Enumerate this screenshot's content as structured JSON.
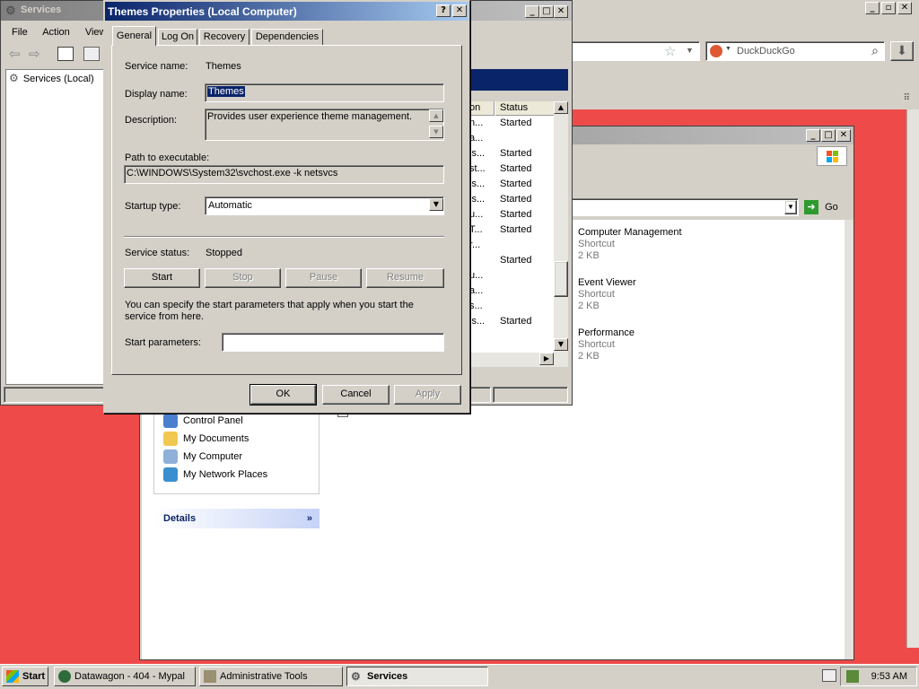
{
  "browser": {
    "search_placeholder": "DuckDuckGo",
    "win_controls": [
      "_",
      "□",
      "✕"
    ]
  },
  "explorer": {
    "address_go": "Go",
    "files": [
      {
        "name": "Computer Management",
        "type": "Shortcut",
        "size": "2 KB"
      },
      {
        "name": "Event Viewer",
        "type": "Shortcut",
        "size": "2 KB"
      },
      {
        "name": "Performance",
        "type": "Shortcut",
        "size": "2 KB"
      }
    ],
    "other_places": [
      "Control Panel",
      "My Documents",
      "My Computer",
      "My Network Places"
    ],
    "details_label": "Details"
  },
  "services_window": {
    "title": "Services",
    "menu": [
      "File",
      "Action",
      "View"
    ],
    "tree_item": "Services (Local)",
    "col_name_partial": "on",
    "col_status": "Status",
    "rows": [
      {
        "name": "n...",
        "status": "Started"
      },
      {
        "name": "a...",
        "status": ""
      },
      {
        "name": "is...",
        "status": "Started"
      },
      {
        "name": "st...",
        "status": "Started"
      },
      {
        "name": "is...",
        "status": "Started"
      },
      {
        "name": "is...",
        "status": "Started"
      },
      {
        "name": "u...",
        "status": "Started"
      },
      {
        "name": "T...",
        "status": "Started"
      },
      {
        "name": "r...",
        "status": ""
      },
      {
        "name": "",
        "status": "Started"
      },
      {
        "name": "u...",
        "status": ""
      },
      {
        "name": "a...",
        "status": ""
      },
      {
        "name": "s...",
        "status": ""
      },
      {
        "name": "is...",
        "status": "Started"
      },
      {
        "name": "",
        "status": ""
      }
    ]
  },
  "dialog": {
    "title": "Themes Properties (Local Computer)",
    "help": "?",
    "close": "✕",
    "tabs": [
      "General",
      "Log On",
      "Recovery",
      "Dependencies"
    ],
    "service_name_label": "Service name:",
    "service_name": "Themes",
    "display_name_label": "Display name:",
    "display_name": "Themes",
    "description_label": "Description:",
    "description": "Provides user experience theme management.",
    "path_label": "Path to executable:",
    "path": "C:\\WINDOWS\\System32\\svchost.exe -k netsvcs",
    "startup_label": "Startup type:",
    "startup_value": "Automatic",
    "status_label": "Service status:",
    "status_value": "Stopped",
    "btn_start": "Start",
    "btn_stop": "Stop",
    "btn_pause": "Pause",
    "btn_resume": "Resume",
    "hint": "You can specify the start parameters that apply when you start the service from here.",
    "params_label": "Start parameters:",
    "params_value": "",
    "ok": "OK",
    "cancel": "Cancel",
    "apply": "Apply"
  },
  "taskbar": {
    "start": "Start",
    "items": [
      {
        "label": "Datawagon - 404 - Mypal"
      },
      {
        "label": "Administrative Tools"
      },
      {
        "label": "Services"
      }
    ],
    "clock": "9:53 AM"
  },
  "colors": {
    "desktop_red": "#ef4a4a",
    "title_active": "#0a246a",
    "taskbar": "#d4d0c8"
  }
}
